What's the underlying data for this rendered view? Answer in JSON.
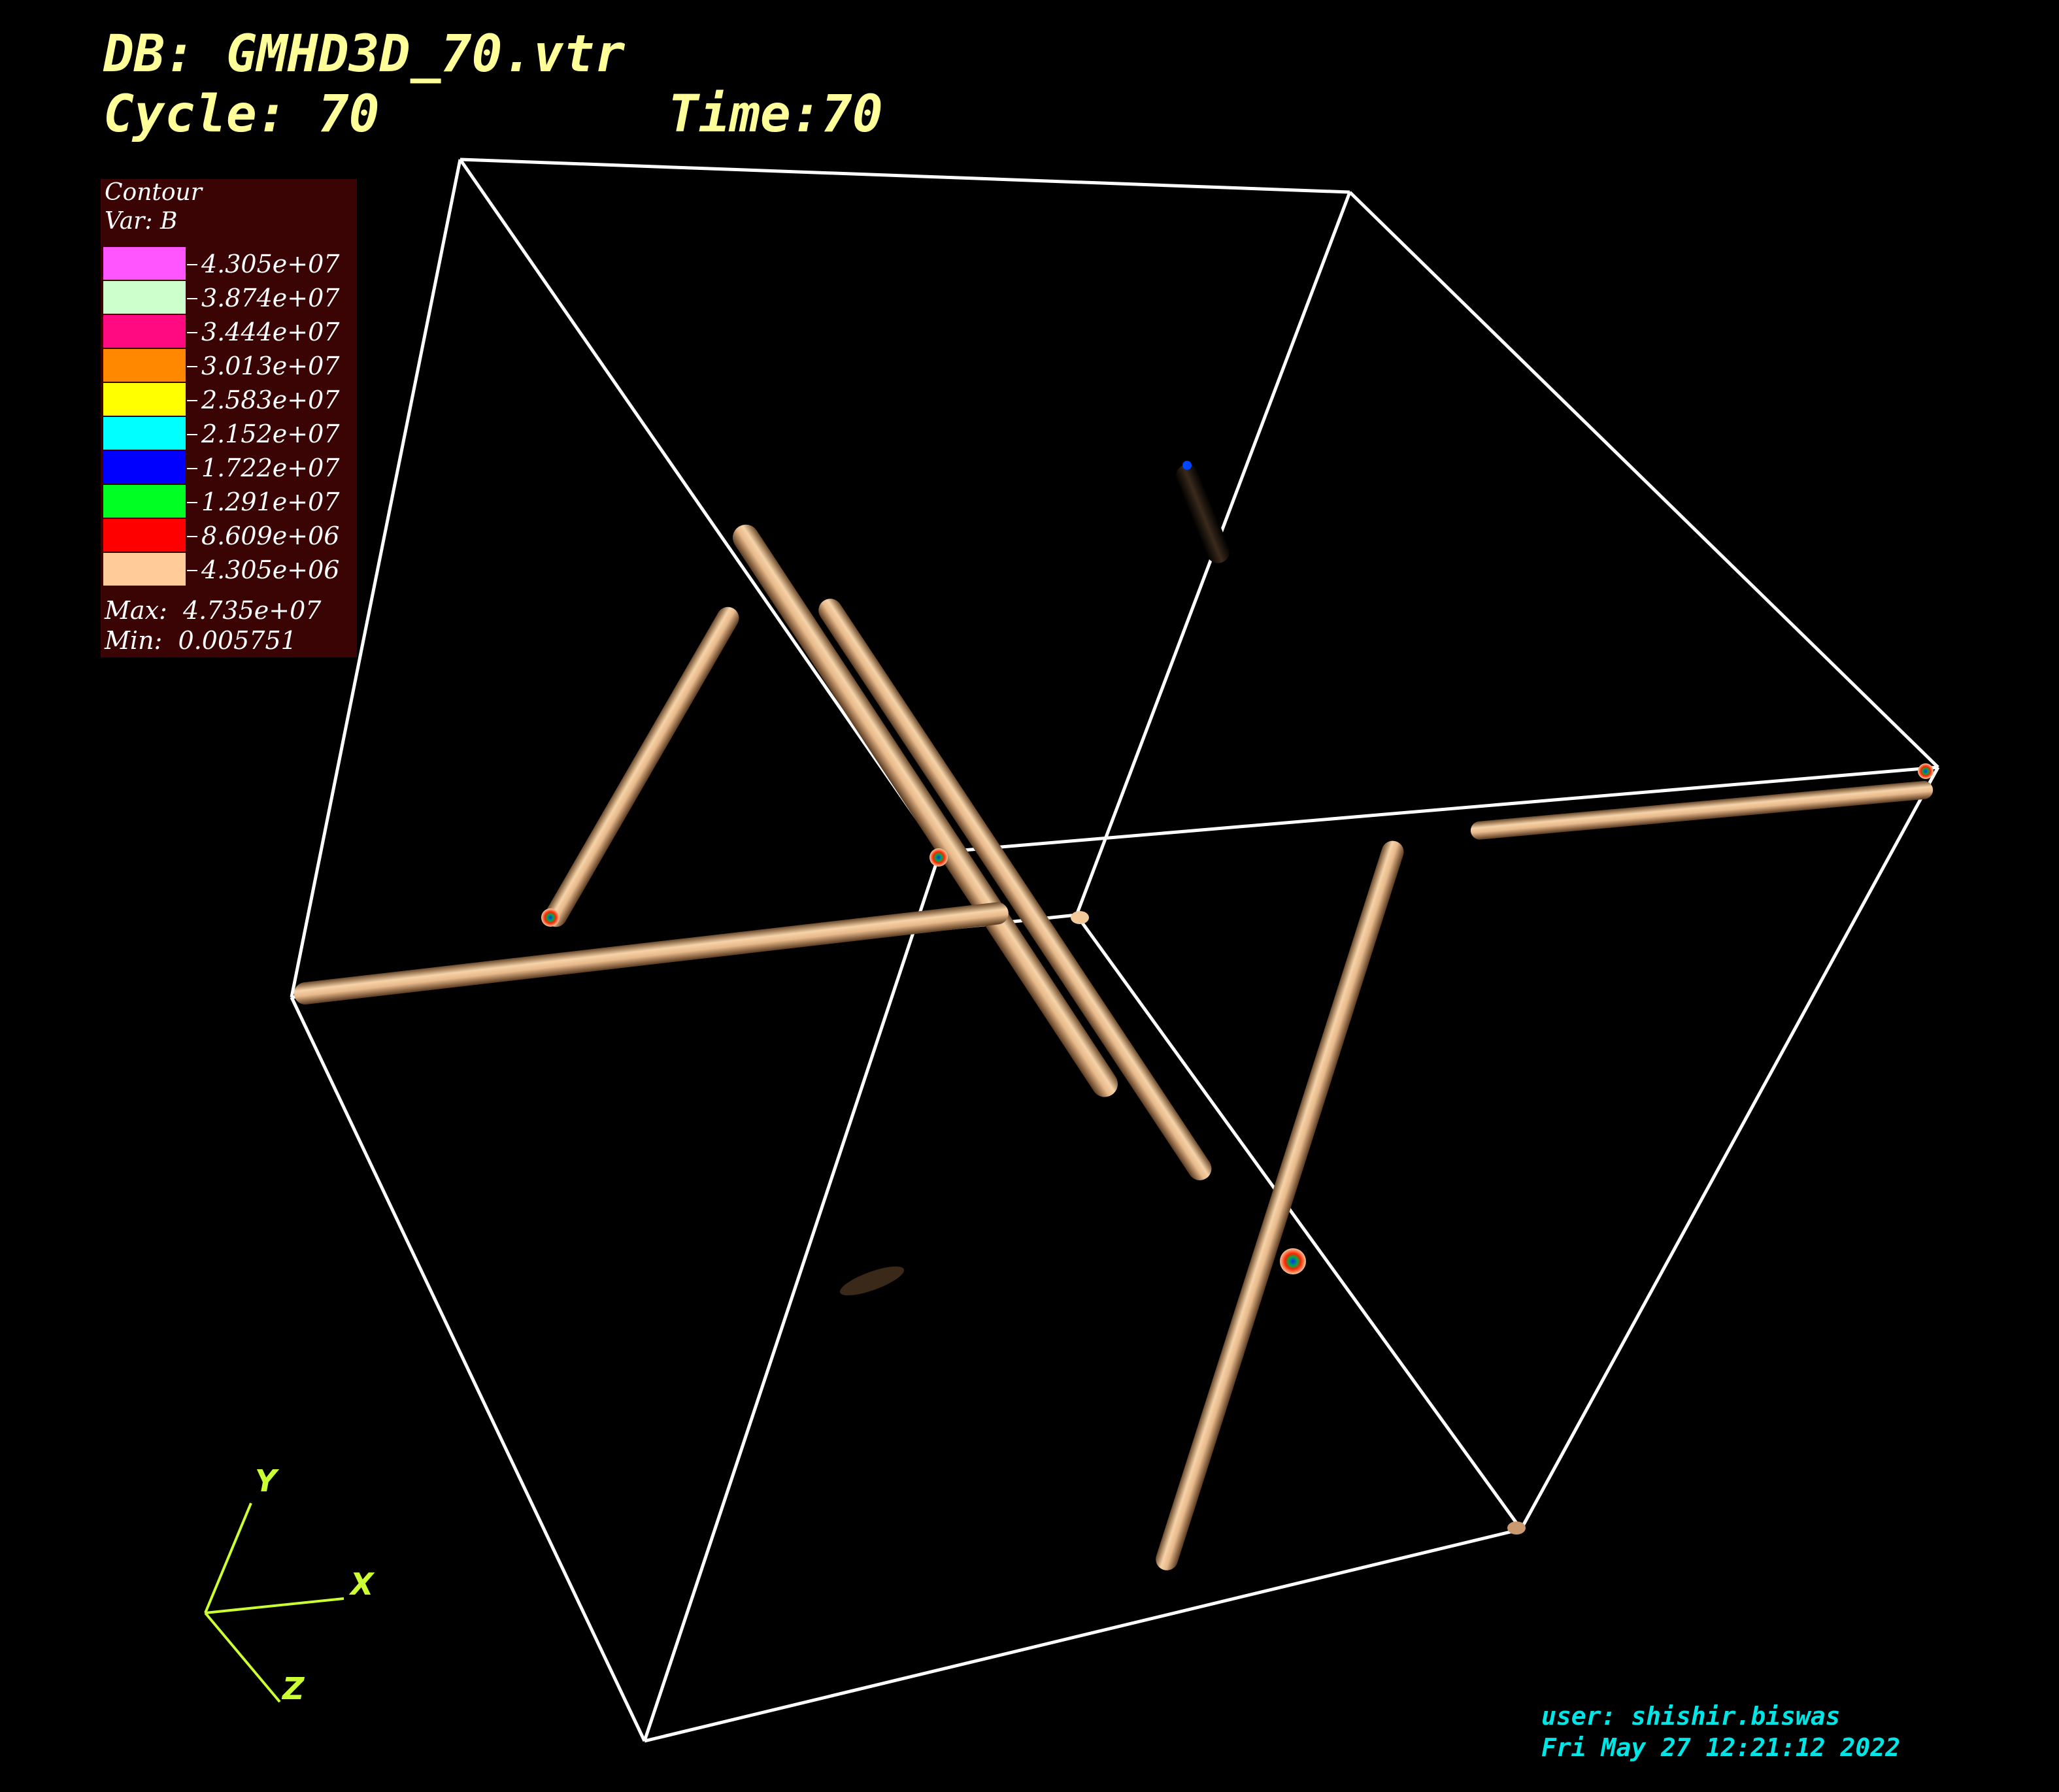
{
  "header": {
    "db_line": "DB: GMHD3D_70.vtr",
    "cycle_line": "Cycle: 70",
    "time_line": "Time:70"
  },
  "legend": {
    "title": "Contour",
    "var": "Var: B",
    "levels": [
      {
        "label": "4.305e+07",
        "color": "#ff55ff"
      },
      {
        "label": "3.874e+07",
        "color": "#ccffcc"
      },
      {
        "label": "3.444e+07",
        "color": "#ff0a80"
      },
      {
        "label": "3.013e+07",
        "color": "#ff8800"
      },
      {
        "label": "2.583e+07",
        "color": "#ffff00"
      },
      {
        "label": "2.152e+07",
        "color": "#00ffff"
      },
      {
        "label": "1.722e+07",
        "color": "#0000ff"
      },
      {
        "label": "1.291e+07",
        "color": "#00ff22"
      },
      {
        "label": "8.609e+06",
        "color": "#ff0000"
      },
      {
        "label": "4.305e+06",
        "color": "#ffcc99"
      }
    ],
    "max": "Max:  4.735e+07",
    "min": "Min:  0.005751"
  },
  "triad": {
    "y": "Y",
    "x": "X",
    "z": "Z",
    "color": "#ccff33"
  },
  "footer": {
    "user": "user: shishir.biswas",
    "date": "Fri May 27 12:21:12 2022"
  },
  "colors": {
    "background": "#000000",
    "box": "#ffffff",
    "tube": "#f2c99a",
    "header": "#ffff99",
    "footer": "#00e5e5"
  }
}
